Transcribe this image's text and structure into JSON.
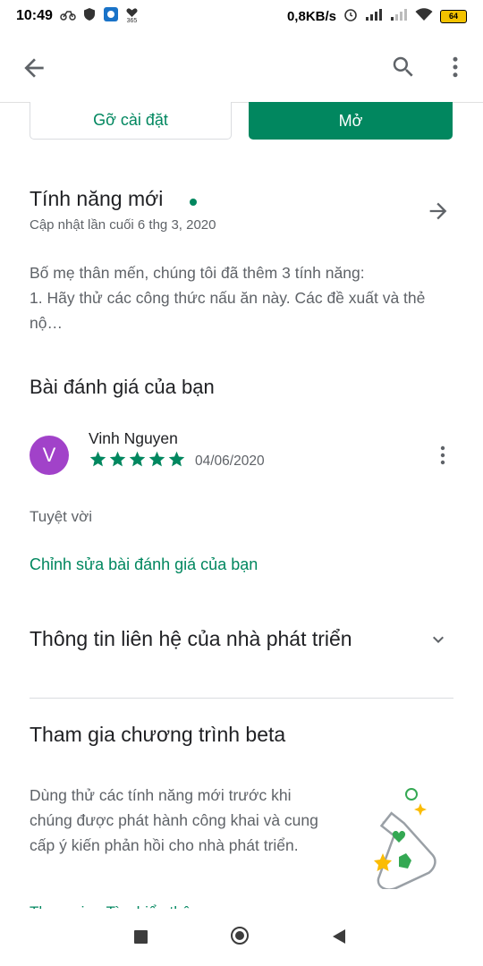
{
  "status_bar": {
    "time": "10:49",
    "speed": "0,8KB/s",
    "battery": "64",
    "mini_label": "365"
  },
  "buttons": {
    "uninstall": "Gỡ cài đặt",
    "open": "Mở"
  },
  "whats_new": {
    "title": "Tính năng mới",
    "updated": "Cập nhật lần cuối 6 thg 3, 2020",
    "body": "Bố mẹ thân mến, chúng tôi đã thêm 3 tính năng:\n1. Hãy thử các công thức nấu ăn này. Các đề xuất và thẻ nộ…"
  },
  "review": {
    "section_title": "Bài đánh giá của bạn",
    "avatar_letter": "V",
    "avatar_color": "#a142c9",
    "name": "Vinh Nguyen",
    "rating": 5,
    "date": "04/06/2020",
    "text": "Tuyệt vời",
    "edit_link": "Chỉnh sửa bài đánh giá của bạn"
  },
  "developer": {
    "title": "Thông tin liên hệ của nhà phát triển"
  },
  "beta": {
    "title": "Tham gia chương trình beta",
    "body": "Dùng thử các tính năng mới trước khi chúng được phát hành công khai và cung cấp ý kiến phản hồi cho nhà phát triển.",
    "link": "Tham gia · Tìm hiểu thêm"
  },
  "colors": {
    "accent": "#01875f",
    "star": "#01875f"
  }
}
